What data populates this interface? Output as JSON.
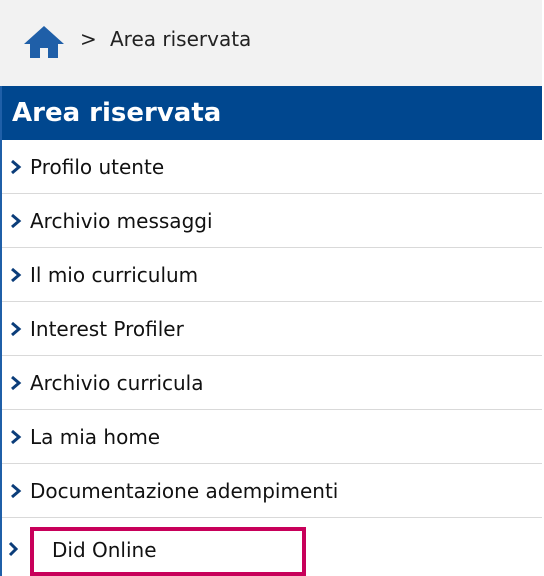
{
  "breadcrumb": {
    "home_icon": "home-icon",
    "separator": ">",
    "current": "Area riservata"
  },
  "panel": {
    "title": "Area riservata",
    "header_color": "#00478f"
  },
  "menu": {
    "items": [
      {
        "label": "Profilo utente"
      },
      {
        "label": "Archivio messaggi"
      },
      {
        "label": "Il mio curriculum"
      },
      {
        "label": "Interest Profiler"
      },
      {
        "label": "Archivio curricula"
      },
      {
        "label": "La mia home"
      },
      {
        "label": "Documentazione adempimenti"
      }
    ],
    "highlighted": {
      "label": "Did Online",
      "highlight_color": "#c8005a"
    }
  }
}
